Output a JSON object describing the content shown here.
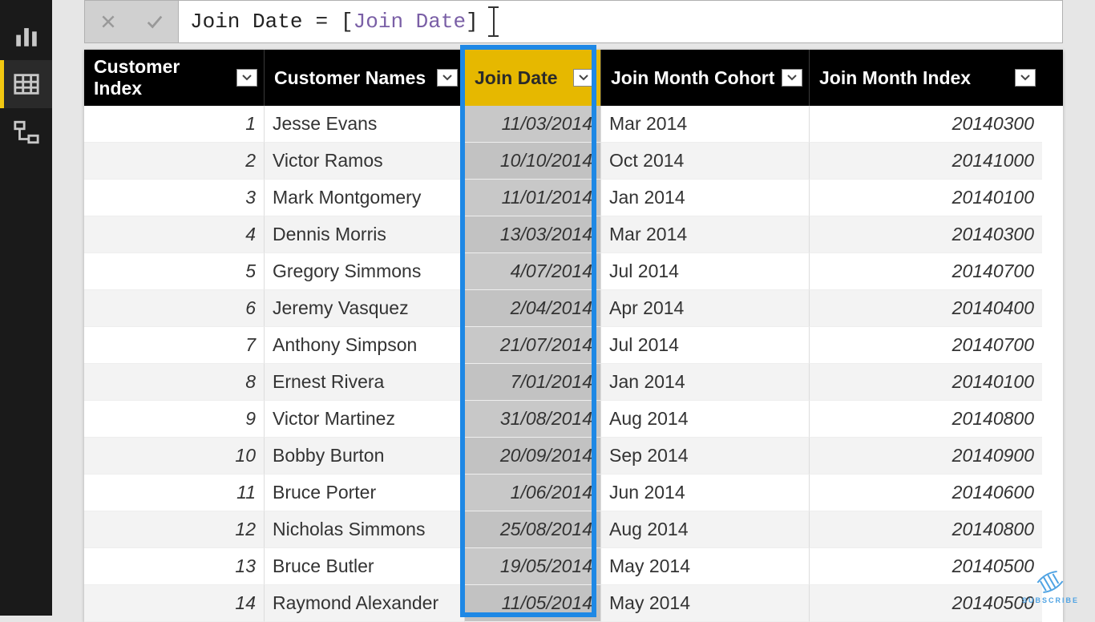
{
  "formula": {
    "measure_name": "Join Date",
    "equals": "=",
    "open_bracket": "[",
    "column_ref": "Join Date",
    "close_bracket": "]"
  },
  "columns": [
    {
      "label": "Customer Index"
    },
    {
      "label": "Customer Names"
    },
    {
      "label": "Join Date"
    },
    {
      "label": "Join Month Cohort"
    },
    {
      "label": "Join Month Index"
    }
  ],
  "selected_column_index": 2,
  "rows": [
    {
      "idx": "1",
      "name": "Jesse Evans",
      "date": "11/03/2014",
      "cohort": "Mar 2014",
      "mindex": "20140300"
    },
    {
      "idx": "2",
      "name": "Victor Ramos",
      "date": "10/10/2014",
      "cohort": "Oct 2014",
      "mindex": "20141000"
    },
    {
      "idx": "3",
      "name": "Mark Montgomery",
      "date": "11/01/2014",
      "cohort": "Jan 2014",
      "mindex": "20140100"
    },
    {
      "idx": "4",
      "name": "Dennis Morris",
      "date": "13/03/2014",
      "cohort": "Mar 2014",
      "mindex": "20140300"
    },
    {
      "idx": "5",
      "name": "Gregory Simmons",
      "date": "4/07/2014",
      "cohort": "Jul 2014",
      "mindex": "20140700"
    },
    {
      "idx": "6",
      "name": "Jeremy Vasquez",
      "date": "2/04/2014",
      "cohort": "Apr 2014",
      "mindex": "20140400"
    },
    {
      "idx": "7",
      "name": "Anthony Simpson",
      "date": "21/07/2014",
      "cohort": "Jul 2014",
      "mindex": "20140700"
    },
    {
      "idx": "8",
      "name": "Ernest Rivera",
      "date": "7/01/2014",
      "cohort": "Jan 2014",
      "mindex": "20140100"
    },
    {
      "idx": "9",
      "name": "Victor Martinez",
      "date": "31/08/2014",
      "cohort": "Aug 2014",
      "mindex": "20140800"
    },
    {
      "idx": "10",
      "name": "Bobby Burton",
      "date": "20/09/2014",
      "cohort": "Sep 2014",
      "mindex": "20140900"
    },
    {
      "idx": "11",
      "name": "Bruce Porter",
      "date": "1/06/2014",
      "cohort": "Jun 2014",
      "mindex": "20140600"
    },
    {
      "idx": "12",
      "name": "Nicholas Simmons",
      "date": "25/08/2014",
      "cohort": "Aug 2014",
      "mindex": "20140800"
    },
    {
      "idx": "13",
      "name": "Bruce Butler",
      "date": "19/05/2014",
      "cohort": "May 2014",
      "mindex": "20140500"
    },
    {
      "idx": "14",
      "name": "Raymond Alexander",
      "date": "11/05/2014",
      "cohort": "May 2014",
      "mindex": "20140500"
    }
  ],
  "subscribe_label": "SUBSCRIBE"
}
